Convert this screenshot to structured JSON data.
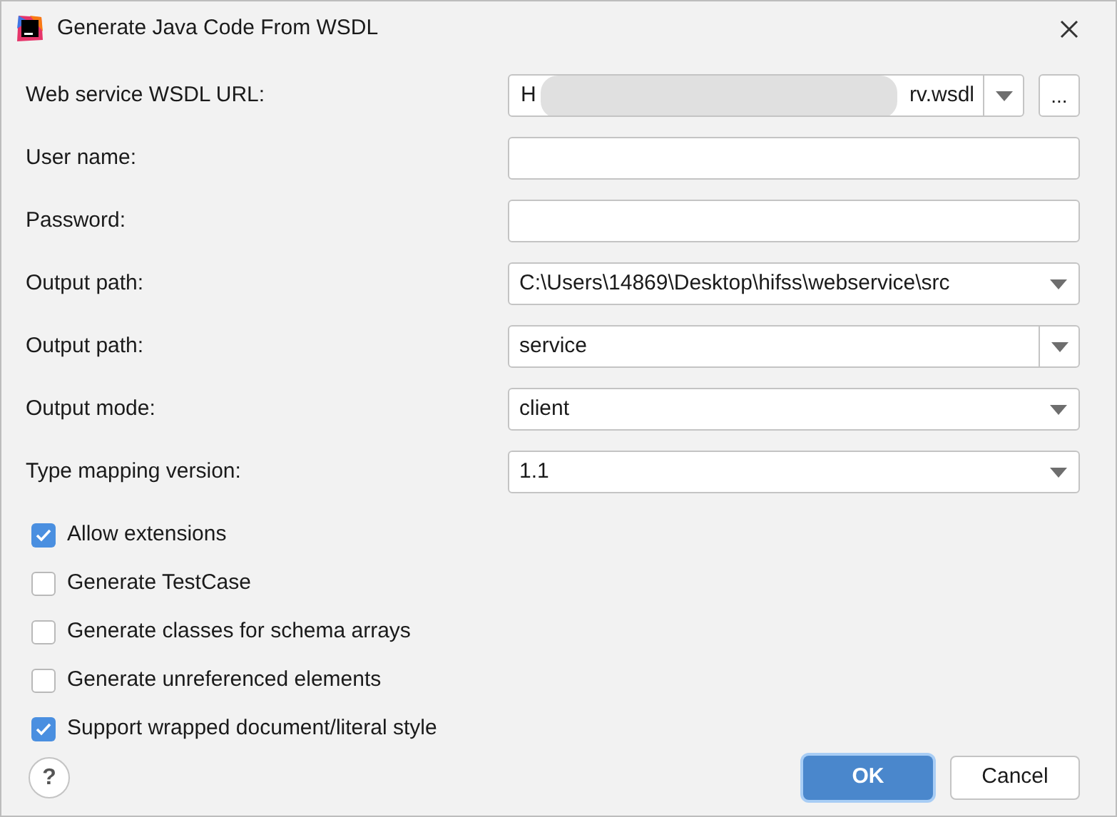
{
  "window": {
    "title": "Generate Java Code From WSDL"
  },
  "fields": [
    {
      "label": "Web service WSDL URL:",
      "kind": "url",
      "value_start": "H",
      "value_end": "rv.wsdl",
      "browse": "..."
    },
    {
      "label": "User name:",
      "kind": "text"
    },
    {
      "label": "Password:",
      "kind": "text"
    },
    {
      "label": "Output path:",
      "kind": "select",
      "value": "C:\\Users\\14869\\Desktop\\hifss\\webservice\\src"
    },
    {
      "label": "Output path:",
      "kind": "combo",
      "value": "service"
    },
    {
      "label": "Output mode:",
      "kind": "select",
      "value": "client"
    },
    {
      "label": "Type mapping version:",
      "kind": "select",
      "value": "1.1"
    }
  ],
  "checkboxes": [
    {
      "label": "Allow extensions",
      "checked": true
    },
    {
      "label": "Generate TestCase",
      "checked": false
    },
    {
      "label": "Generate classes for schema arrays",
      "checked": false
    },
    {
      "label": "Generate unreferenced elements",
      "checked": false
    },
    {
      "label": "Support wrapped document/literal style",
      "checked": true
    }
  ],
  "help": "?",
  "buttons": [
    {
      "label": "OK",
      "kind": "primary"
    },
    {
      "label": "Cancel",
      "kind": "secondary"
    }
  ]
}
